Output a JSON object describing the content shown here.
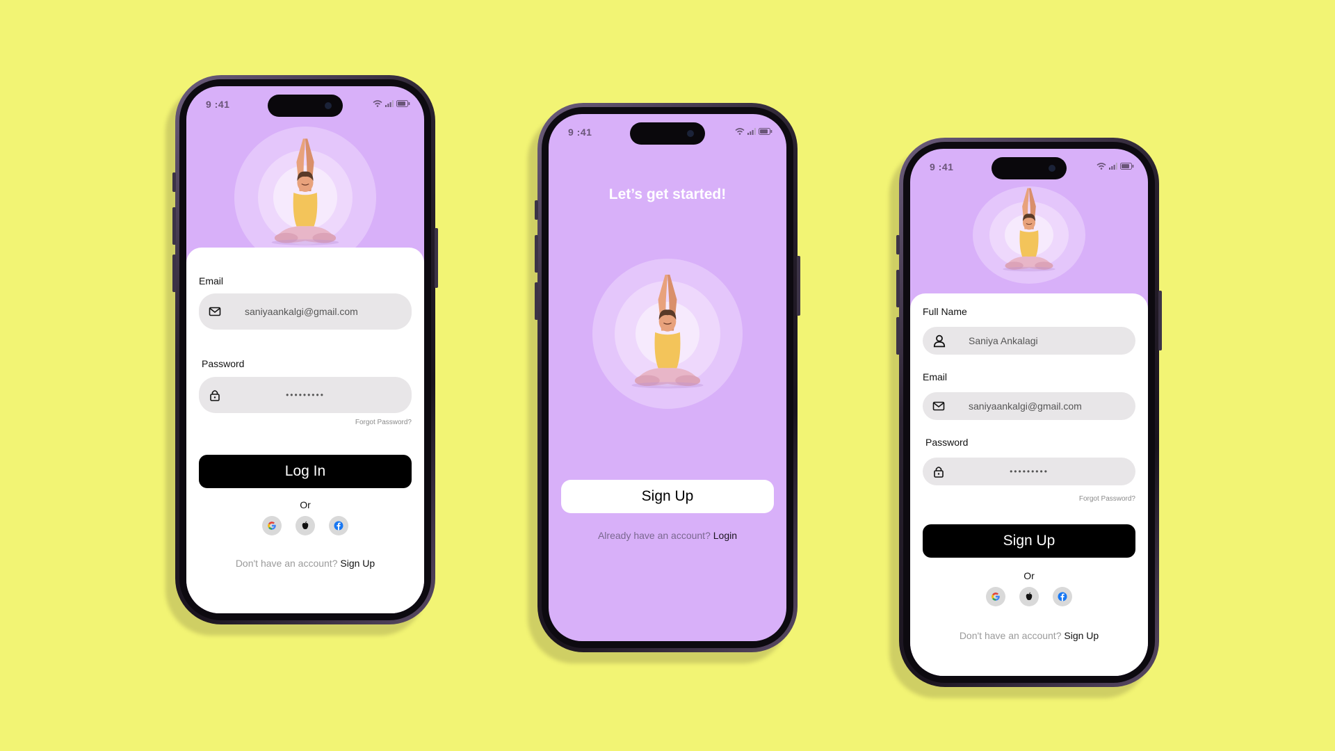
{
  "status": {
    "time": "9 :41"
  },
  "login": {
    "email_label": "Email",
    "email_value": "saniyaankalgi@gmail.com",
    "password_label": "Password",
    "password_value": "•••••••••",
    "forgot": "Forgot Password?",
    "button": "Log In",
    "or": "Or",
    "footer_text": "Don't have an account?",
    "footer_link": "Sign Up"
  },
  "welcome": {
    "title": "Let’s get started!",
    "button": "Sign Up",
    "footer_text": "Already have an account?",
    "footer_link": "Login"
  },
  "signup": {
    "name_label": "Full Name",
    "name_value": "Saniya Ankalagi",
    "email_label": "Email",
    "email_value": "saniyaankalgi@gmail.com",
    "password_label": "Password",
    "password_value": "•••••••••",
    "forgot": "Forgot Password?",
    "button": "Sign Up",
    "or": "Or",
    "footer_text": "Don't have an account?",
    "footer_link": "Sign Up"
  },
  "social_icons": [
    "google-icon",
    "apple-icon",
    "facebook-icon"
  ],
  "colors": {
    "background": "#f2f474",
    "screen_purple": "#d8b0f9",
    "button_dark": "#000000",
    "field_gray": "#e8e6e8"
  }
}
